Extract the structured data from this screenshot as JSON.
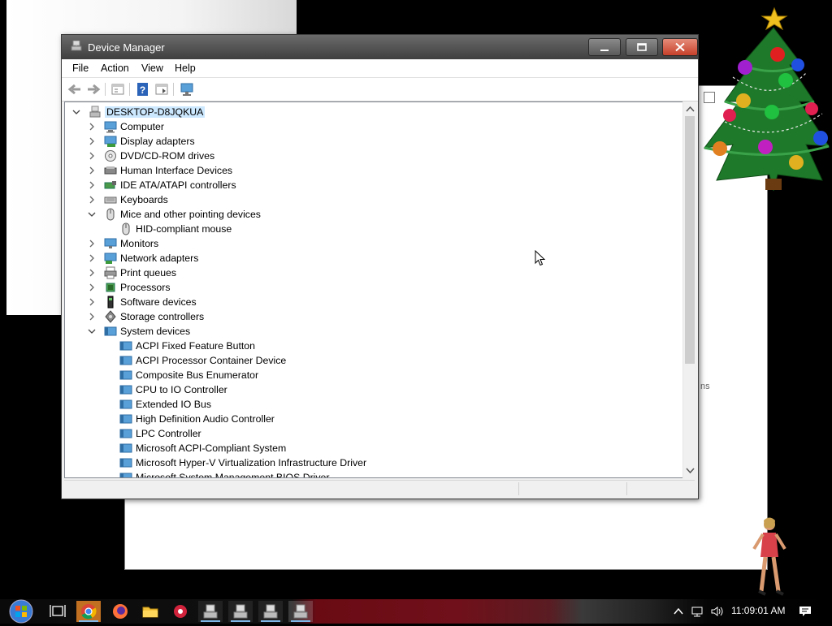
{
  "window": {
    "title": "Device Manager"
  },
  "menubar": {
    "items": [
      "File",
      "Action",
      "View",
      "Help"
    ]
  },
  "tree": {
    "root": "DESKTOP-D8JQKUA",
    "categories": [
      {
        "label": "Computer",
        "expanded": false
      },
      {
        "label": "Display adapters",
        "expanded": false
      },
      {
        "label": "DVD/CD-ROM drives",
        "expanded": false
      },
      {
        "label": "Human Interface Devices",
        "expanded": false
      },
      {
        "label": "IDE ATA/ATAPI controllers",
        "expanded": false
      },
      {
        "label": "Keyboards",
        "expanded": false
      },
      {
        "label": "Mice and other pointing devices",
        "expanded": true
      },
      {
        "label": "Monitors",
        "expanded": false
      },
      {
        "label": "Network adapters",
        "expanded": false
      },
      {
        "label": "Print queues",
        "expanded": false
      },
      {
        "label": "Processors",
        "expanded": false
      },
      {
        "label": "Software devices",
        "expanded": false
      },
      {
        "label": "Storage controllers",
        "expanded": false
      },
      {
        "label": "System devices",
        "expanded": true
      }
    ],
    "mice_children": [
      "HID-compliant mouse"
    ],
    "system_children": [
      "ACPI Fixed Feature Button",
      "ACPI Processor Container Device",
      "Composite Bus Enumerator",
      "CPU to IO Controller",
      "Extended IO Bus",
      "High Definition Audio Controller",
      "LPC Controller",
      "Microsoft ACPI-Compliant System",
      "Microsoft Hyper-V Virtualization Infrastructure Driver",
      "Microsoft System Management BIOS Driver"
    ]
  },
  "background_window": {
    "partial_text": "ns"
  },
  "taskbar": {
    "clock": "11:09:01 AM",
    "items": [
      "start-orb",
      "task-view",
      "chrome",
      "firefox",
      "file-explorer",
      "app-red",
      "device-manager-1",
      "device-manager-2",
      "device-manager-3",
      "device-manager-4"
    ]
  },
  "colors": {
    "selection": "#cce8ff",
    "title_bar": "#4a4a4a",
    "close_button": "#c7402a"
  }
}
